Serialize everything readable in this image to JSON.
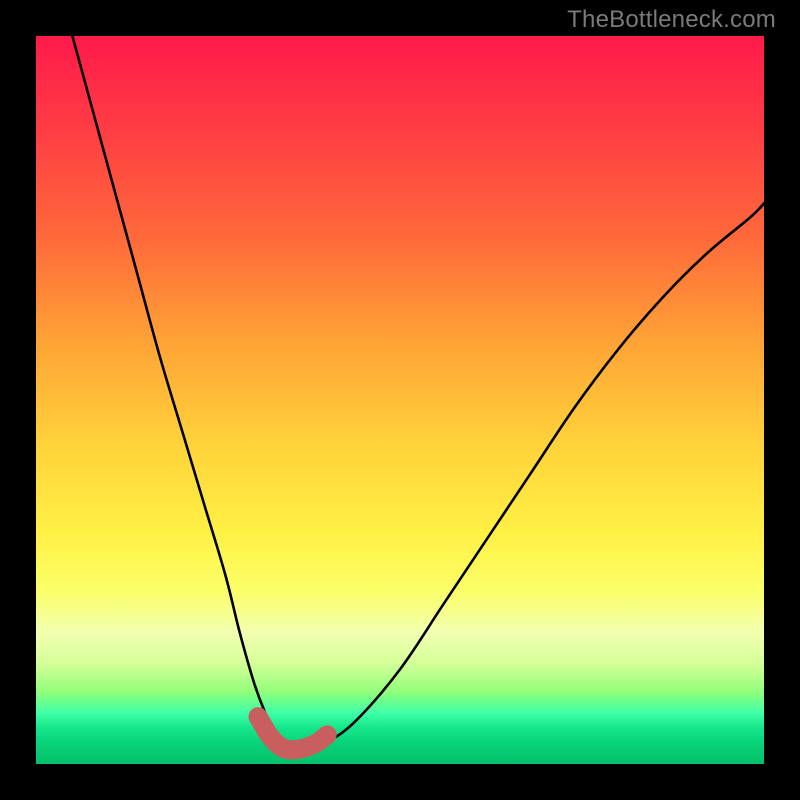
{
  "watermark": {
    "text": "TheBottleneck.com"
  },
  "colors": {
    "frame": "#000000",
    "curve_stroke": "#000000",
    "marker_stroke": "#c95e5e",
    "marker_fill": "#c95e5e"
  },
  "chart_data": {
    "type": "line",
    "title": "",
    "xlabel": "",
    "ylabel": "",
    "x_range": [
      0,
      100
    ],
    "y_range": [
      0,
      100
    ],
    "series": [
      {
        "name": "bottleneck-curve",
        "x": [
          5,
          8,
          11,
          14,
          17,
          20,
          23,
          26,
          28,
          30,
          31.5,
          33,
          34.5,
          36,
          38,
          40,
          44,
          50,
          56,
          62,
          68,
          74,
          80,
          86,
          92,
          98,
          100
        ],
        "y": [
          100,
          89,
          78,
          67,
          56,
          46,
          36,
          26,
          18,
          11,
          7,
          4,
          2.5,
          2,
          2.3,
          3,
          6,
          13,
          22,
          31,
          40,
          49,
          57,
          64,
          70,
          75,
          77
        ]
      }
    ],
    "markers": {
      "name": "highlighted-band",
      "x": [
        30.5,
        32,
        33.3,
        34.5,
        36,
        37.4,
        38.7,
        40
      ],
      "y": [
        6.5,
        4.0,
        2.6,
        2.0,
        2.0,
        2.4,
        3.0,
        4.0
      ]
    }
  }
}
